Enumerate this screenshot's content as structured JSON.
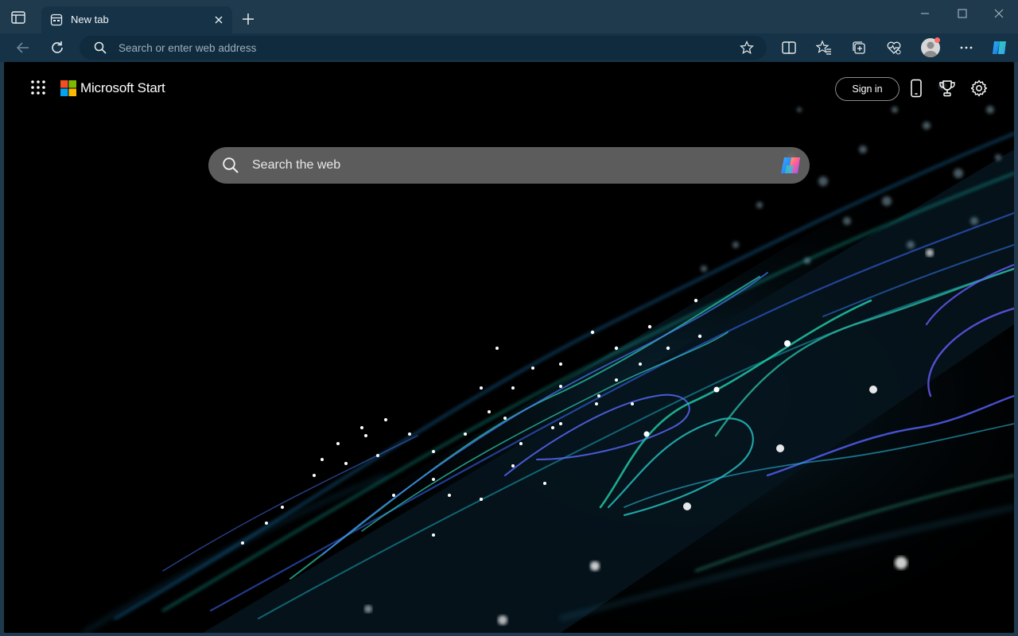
{
  "browser": {
    "tab": {
      "title": "New tab"
    },
    "address_bar": {
      "placeholder": "Search or enter web address"
    }
  },
  "page": {
    "brand": "Microsoft Start",
    "sign_in_label": "Sign in",
    "search": {
      "placeholder": "Search the web"
    }
  },
  "icons": {
    "sidebar_toggle": "tab-actions-icon",
    "tab": "new-tab-page-icon",
    "close": "close-icon",
    "new_tab": "plus-icon",
    "back": "back-arrow-icon",
    "refresh": "refresh-icon",
    "search": "search-icon",
    "favorite": "star-icon",
    "split_screen": "split-screen-icon",
    "favorites": "favorites-icon",
    "collections": "collections-icon",
    "browser_essentials": "heart-pulse-icon",
    "more": "more-icon",
    "copilot": "copilot-icon",
    "apps": "app-launcher-icon",
    "phone": "phone-icon",
    "rewards": "trophy-icon",
    "settings": "gear-icon"
  },
  "colors": {
    "frame": "#1f3a4d",
    "toolbar": "#153246",
    "content_bg": "#000000",
    "ms_red": "#f25022",
    "ms_green": "#7fba00",
    "ms_blue": "#00a4ef",
    "ms_yellow": "#ffb900"
  }
}
